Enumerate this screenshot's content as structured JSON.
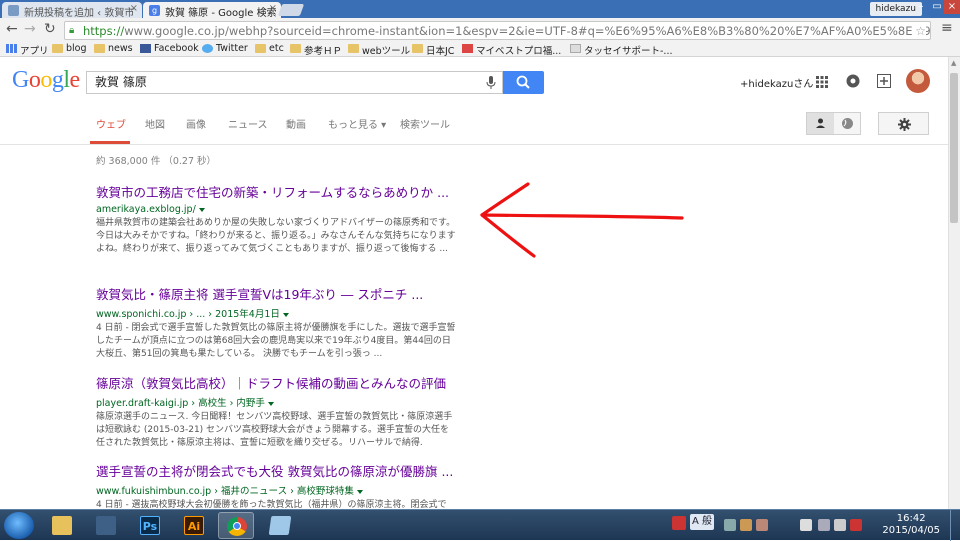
{
  "browser": {
    "tabs": [
      {
        "title": "新規投稿を追加 ‹ 敦賀市",
        "active": false
      },
      {
        "title": "敦賀 篠原 - Google 検索",
        "active": true
      }
    ],
    "user_chip": "hidekazu",
    "url_scheme": "https://",
    "url_rest": "www.google.co.jp/webhp?sourceid=chrome-instant&ion=1&espv=2&ie=UTF-8#q=%E6%95%A6%E8%B3%80%20%E7%AF%A0%E5%8E%9F",
    "bookmarks": [
      {
        "label": "アプリ",
        "icon": "apps-icon"
      },
      {
        "label": "blog",
        "icon": "folder-icon"
      },
      {
        "label": "news",
        "icon": "folder-icon"
      },
      {
        "label": "Facebook",
        "icon": "facebook-icon"
      },
      {
        "label": "Twitter",
        "icon": "twitter-icon"
      },
      {
        "label": "etc",
        "icon": "folder-icon"
      },
      {
        "label": "参考ＨＰ",
        "icon": "folder-icon"
      },
      {
        "label": "webツール",
        "icon": "folder-icon"
      },
      {
        "label": "日本JC",
        "icon": "folder-icon"
      },
      {
        "label": "マイベストプロ福...",
        "icon": "page-icon"
      },
      {
        "label": "タッセイサポート-...",
        "icon": "page-icon"
      }
    ]
  },
  "google": {
    "logo": "Google",
    "query": "敦賀 篠原",
    "account": "+hidekazuさん",
    "nav_tabs": [
      "ウェブ",
      "地図",
      "画像",
      "ニュース",
      "動画",
      "もっと見る ▾",
      "検索ツール"
    ],
    "result_stats": "約 368,000 件 （0.27 秒）",
    "results": [
      {
        "title": "敦賀市の工務店で住宅の新築・リフォームするならあめりか ...",
        "url": "amerikaya.exblog.jp/",
        "snippet": "福井県敦賀市の建築会社あめりか屋の失敗しない家づくりアドバイザーの篠原秀和です。 今日は大みそかですね。「終わりが来ると、振り返る。」みなさんそんな気持ちになりますよね。終わりが来て、振り返ってみて気づくこともありますが、振り返って後悔する ..."
      },
      {
        "title": "敦賀気比・篠原主将 選手宣誓Ⅴは19年ぶり ― スポニチ ...",
        "url": "www.sponichi.co.jp › ... › 2015年4月1日",
        "snippet": "4 日前 - 閉会式で選手宣誓した敦賀気比の篠原主将が優勝旗を手にした。選抜で選手宣誓したチームが頂点に立つのは第68回大会の鹿児島実以来で19年ぶり4度目。第44回の日大桜丘、第51回の箕島も果たしている。 決勝でもチームを引っ張っ ..."
      },
      {
        "title": "篠原涼（敦賀気比高校）｜ドラフト候補の動画とみんなの評価",
        "url": "player.draft-kaigi.jp › 高校生 › 内野手",
        "snippet": "篠原涼選手のニュース. 今日聞释！センバツ高校野球、選手宣誓の敦賀気比・篠原涼選手は短歌詠む (2015-03-21) センバツ高校野球大会がきょう開幕する。選手宣誓の大任を任された敦賀気比・篠原涼主将は、宣誓に短歌を織り交ぜる。リハーサルで納得."
      },
      {
        "title": "選手宣誓の主将が閉会式でも大役 敦賀気比の篠原涼が優勝旗 ...",
        "url": "www.fukuishimbun.co.jp › 福井のニュース › 高校野球特集",
        "snippet": "4 日前 - 選抜高校野球大会初優勝を飾った敦賀気比（福井県）の篠原涼主将。閉会式で"
      }
    ]
  },
  "taskbar": {
    "apps": [
      "explorer-icon",
      "photoshop-icon",
      "illustrator-icon",
      "chrome-icon",
      "notepad-icon"
    ],
    "ps_label": "Ps",
    "ai_label": "Ai",
    "ime": "A 般",
    "time": "16:42",
    "date": "2015/04/05"
  },
  "colors": {
    "visited_link": "#660099",
    "url_green": "#006621",
    "accent_red": "#dd4b39",
    "search_blue": "#4285f4",
    "annotation_arrow": "#ee1111"
  }
}
